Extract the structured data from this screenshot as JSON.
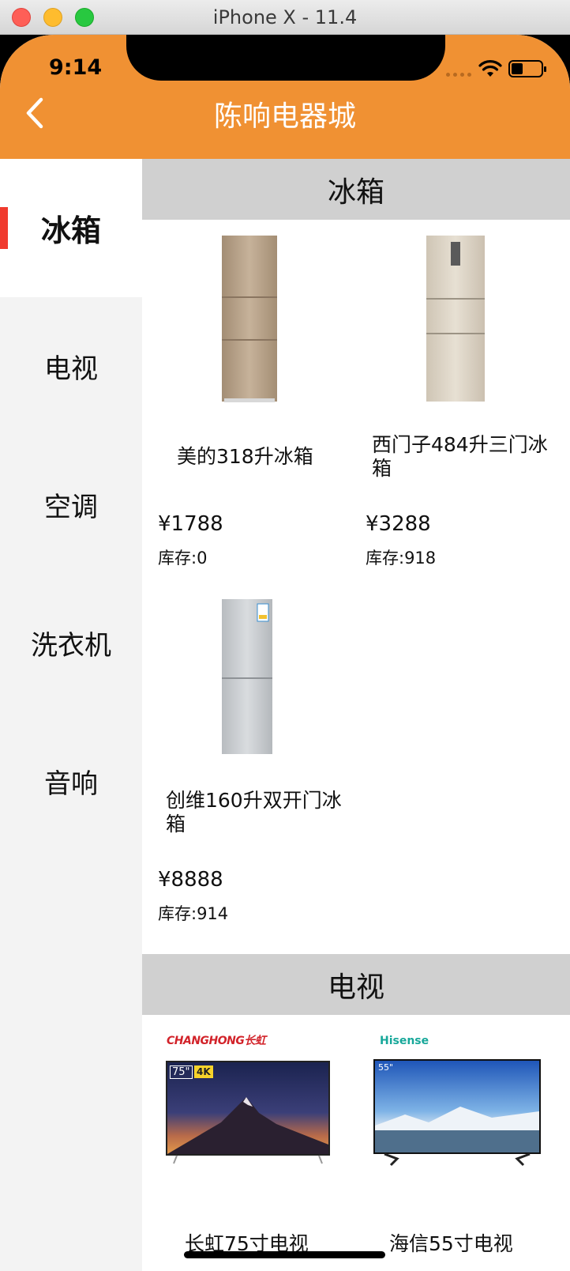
{
  "window": {
    "title": "iPhone X - 11.4"
  },
  "status_bar": {
    "time": "9:14"
  },
  "nav": {
    "title": "陈响电器城"
  },
  "sidebar": {
    "items": [
      {
        "label": "冰箱",
        "active": true
      },
      {
        "label": "电视",
        "active": false
      },
      {
        "label": "空调",
        "active": false
      },
      {
        "label": "洗衣机",
        "active": false
      },
      {
        "label": "音响",
        "active": false
      }
    ]
  },
  "sections": [
    {
      "title": "冰箱",
      "products": [
        {
          "name": "美的318升冰箱",
          "price": "¥1788",
          "stock": "库存:0"
        },
        {
          "name": "西门子484升三门冰箱",
          "price": "¥3288",
          "stock": "库存:918"
        },
        {
          "name": "创维160升双开门冰箱",
          "price": "¥8888",
          "stock": "库存:914"
        }
      ]
    },
    {
      "title": "电视",
      "products": [
        {
          "name": "长虹75寸电视",
          "brand": "CHANGHONG长虹",
          "badge_size": "75\"",
          "badge_4k": "4K"
        },
        {
          "name": "海信55寸电视",
          "brand": "Hisense",
          "badge_size": "55\""
        }
      ]
    }
  ],
  "colors": {
    "header": "#f09133",
    "sidebar_bg": "#f3f3f3",
    "section_header_bg": "#d0d0d0",
    "active_indicator": "#f03a2e"
  }
}
